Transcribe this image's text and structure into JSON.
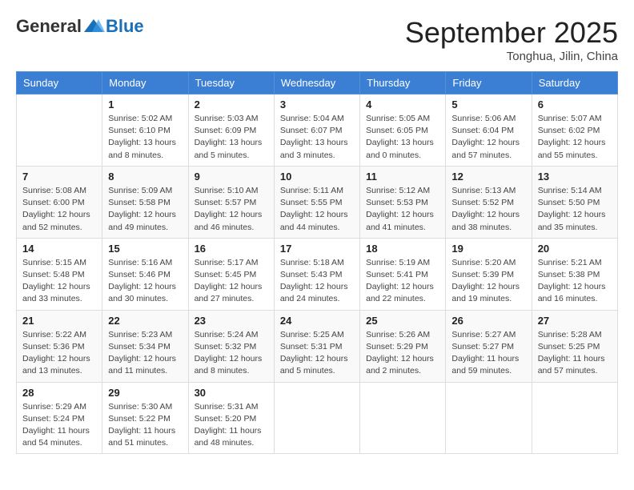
{
  "header": {
    "logo_general": "General",
    "logo_blue": "Blue",
    "month_title": "September 2025",
    "location": "Tonghua, Jilin, China"
  },
  "days_of_week": [
    "Sunday",
    "Monday",
    "Tuesday",
    "Wednesday",
    "Thursday",
    "Friday",
    "Saturday"
  ],
  "weeks": [
    [
      {
        "day": "",
        "info": ""
      },
      {
        "day": "1",
        "info": "Sunrise: 5:02 AM\nSunset: 6:10 PM\nDaylight: 13 hours\nand 8 minutes."
      },
      {
        "day": "2",
        "info": "Sunrise: 5:03 AM\nSunset: 6:09 PM\nDaylight: 13 hours\nand 5 minutes."
      },
      {
        "day": "3",
        "info": "Sunrise: 5:04 AM\nSunset: 6:07 PM\nDaylight: 13 hours\nand 3 minutes."
      },
      {
        "day": "4",
        "info": "Sunrise: 5:05 AM\nSunset: 6:05 PM\nDaylight: 13 hours\nand 0 minutes."
      },
      {
        "day": "5",
        "info": "Sunrise: 5:06 AM\nSunset: 6:04 PM\nDaylight: 12 hours\nand 57 minutes."
      },
      {
        "day": "6",
        "info": "Sunrise: 5:07 AM\nSunset: 6:02 PM\nDaylight: 12 hours\nand 55 minutes."
      }
    ],
    [
      {
        "day": "7",
        "info": "Sunrise: 5:08 AM\nSunset: 6:00 PM\nDaylight: 12 hours\nand 52 minutes."
      },
      {
        "day": "8",
        "info": "Sunrise: 5:09 AM\nSunset: 5:58 PM\nDaylight: 12 hours\nand 49 minutes."
      },
      {
        "day": "9",
        "info": "Sunrise: 5:10 AM\nSunset: 5:57 PM\nDaylight: 12 hours\nand 46 minutes."
      },
      {
        "day": "10",
        "info": "Sunrise: 5:11 AM\nSunset: 5:55 PM\nDaylight: 12 hours\nand 44 minutes."
      },
      {
        "day": "11",
        "info": "Sunrise: 5:12 AM\nSunset: 5:53 PM\nDaylight: 12 hours\nand 41 minutes."
      },
      {
        "day": "12",
        "info": "Sunrise: 5:13 AM\nSunset: 5:52 PM\nDaylight: 12 hours\nand 38 minutes."
      },
      {
        "day": "13",
        "info": "Sunrise: 5:14 AM\nSunset: 5:50 PM\nDaylight: 12 hours\nand 35 minutes."
      }
    ],
    [
      {
        "day": "14",
        "info": "Sunrise: 5:15 AM\nSunset: 5:48 PM\nDaylight: 12 hours\nand 33 minutes."
      },
      {
        "day": "15",
        "info": "Sunrise: 5:16 AM\nSunset: 5:46 PM\nDaylight: 12 hours\nand 30 minutes."
      },
      {
        "day": "16",
        "info": "Sunrise: 5:17 AM\nSunset: 5:45 PM\nDaylight: 12 hours\nand 27 minutes."
      },
      {
        "day": "17",
        "info": "Sunrise: 5:18 AM\nSunset: 5:43 PM\nDaylight: 12 hours\nand 24 minutes."
      },
      {
        "day": "18",
        "info": "Sunrise: 5:19 AM\nSunset: 5:41 PM\nDaylight: 12 hours\nand 22 minutes."
      },
      {
        "day": "19",
        "info": "Sunrise: 5:20 AM\nSunset: 5:39 PM\nDaylight: 12 hours\nand 19 minutes."
      },
      {
        "day": "20",
        "info": "Sunrise: 5:21 AM\nSunset: 5:38 PM\nDaylight: 12 hours\nand 16 minutes."
      }
    ],
    [
      {
        "day": "21",
        "info": "Sunrise: 5:22 AM\nSunset: 5:36 PM\nDaylight: 12 hours\nand 13 minutes."
      },
      {
        "day": "22",
        "info": "Sunrise: 5:23 AM\nSunset: 5:34 PM\nDaylight: 12 hours\nand 11 minutes."
      },
      {
        "day": "23",
        "info": "Sunrise: 5:24 AM\nSunset: 5:32 PM\nDaylight: 12 hours\nand 8 minutes."
      },
      {
        "day": "24",
        "info": "Sunrise: 5:25 AM\nSunset: 5:31 PM\nDaylight: 12 hours\nand 5 minutes."
      },
      {
        "day": "25",
        "info": "Sunrise: 5:26 AM\nSunset: 5:29 PM\nDaylight: 12 hours\nand 2 minutes."
      },
      {
        "day": "26",
        "info": "Sunrise: 5:27 AM\nSunset: 5:27 PM\nDaylight: 11 hours\nand 59 minutes."
      },
      {
        "day": "27",
        "info": "Sunrise: 5:28 AM\nSunset: 5:25 PM\nDaylight: 11 hours\nand 57 minutes."
      }
    ],
    [
      {
        "day": "28",
        "info": "Sunrise: 5:29 AM\nSunset: 5:24 PM\nDaylight: 11 hours\nand 54 minutes."
      },
      {
        "day": "29",
        "info": "Sunrise: 5:30 AM\nSunset: 5:22 PM\nDaylight: 11 hours\nand 51 minutes."
      },
      {
        "day": "30",
        "info": "Sunrise: 5:31 AM\nSunset: 5:20 PM\nDaylight: 11 hours\nand 48 minutes."
      },
      {
        "day": "",
        "info": ""
      },
      {
        "day": "",
        "info": ""
      },
      {
        "day": "",
        "info": ""
      },
      {
        "day": "",
        "info": ""
      }
    ]
  ]
}
